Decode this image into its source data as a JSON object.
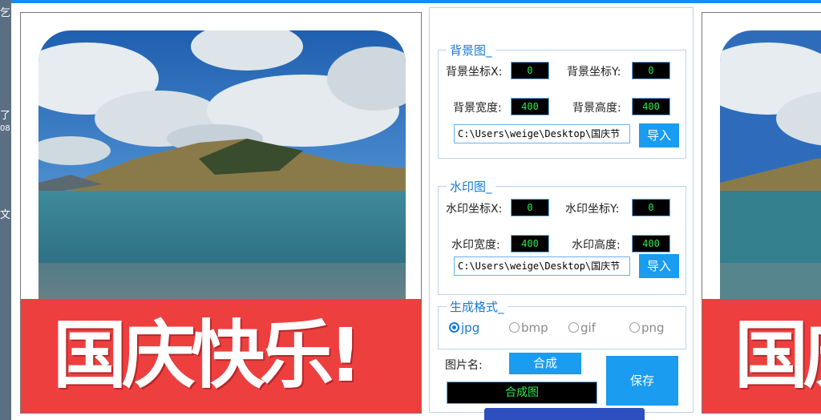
{
  "desktop": {
    "strip_chars": [
      "乞",
      "了",
      "08",
      "文"
    ]
  },
  "preview": {
    "banner_text": "国庆快乐!"
  },
  "background_group": {
    "title": "背景图_",
    "x_label": "背景坐标X:",
    "x_value": "0",
    "y_label": "背景坐标Y:",
    "y_value": "0",
    "width_label": "背景宽度:",
    "width_value": "400",
    "height_label": "背景高度:",
    "height_value": "400",
    "path": "C:\\Users\\weige\\Desktop\\国庆节",
    "import_label": "导入"
  },
  "watermark_group": {
    "title": "水印图_",
    "x_label": "水印坐标X:",
    "x_value": "0",
    "y_label": "水印坐标Y:",
    "y_value": "0",
    "width_label": "水印宽度:",
    "width_value": "400",
    "height_label": "水印高度:",
    "height_value": "400",
    "path": "C:\\Users\\weige\\Desktop\\国庆节",
    "import_label": "导入"
  },
  "format_group": {
    "title": "生成格式_",
    "options": [
      "jpg",
      "bmp",
      "gif",
      "png"
    ],
    "selected": "jpg"
  },
  "output": {
    "name_label": "图片名:",
    "compose_label": "合成",
    "name_value": "合成图",
    "save_label": "保存"
  },
  "colors": {
    "accent": "#1a9cf0",
    "banner": "#ee3f3f",
    "field_text": "#2ee84a"
  }
}
